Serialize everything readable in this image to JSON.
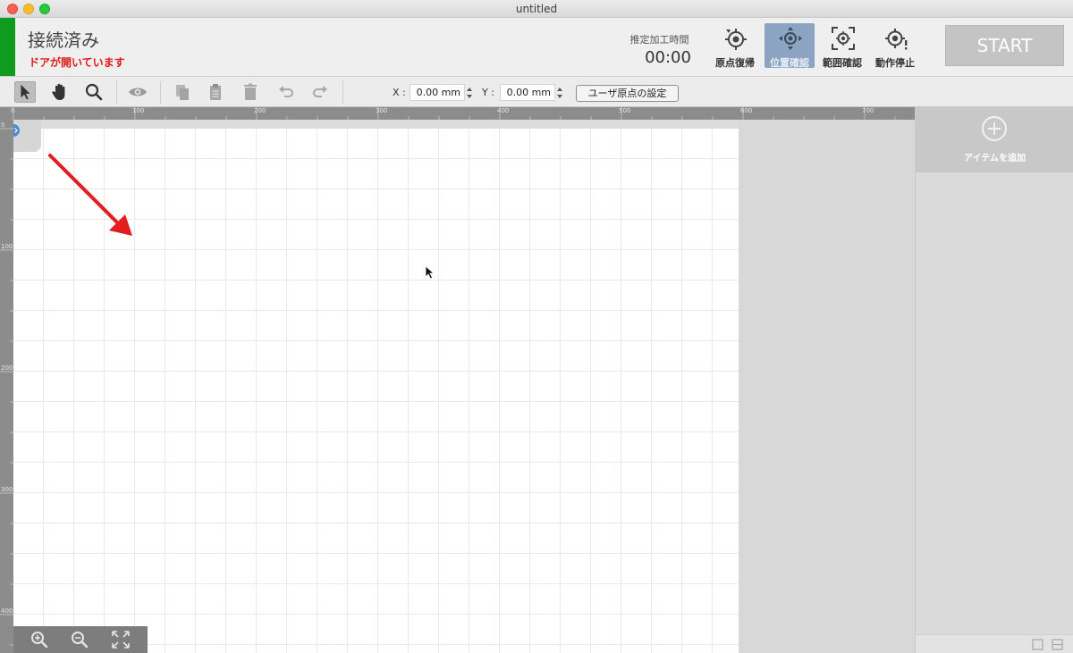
{
  "window": {
    "title": "untitled"
  },
  "header": {
    "connection_status": "接続済み",
    "door_warning": "ドアが開いています",
    "time_label": "推定加工時間",
    "time_value": "00:00",
    "tools": [
      {
        "label": "原点復帰",
        "icon": "home-target-icon"
      },
      {
        "label": "位置確認",
        "icon": "position-check-icon"
      },
      {
        "label": "範囲確認",
        "icon": "range-check-icon"
      },
      {
        "label": "動作停止",
        "icon": "stop-target-icon"
      }
    ],
    "start_label": "START",
    "status_color": "#0f9b1e",
    "warning_color": "#e01b1b"
  },
  "toolbar": {
    "x_label": "X :",
    "x_value": "0.00 mm",
    "y_label": "Y :",
    "y_value": "0.00 mm",
    "origin_button": "ユーザ原点の設定"
  },
  "rulers": {
    "top": [
      "0",
      "100",
      "200",
      "300",
      "400",
      "500",
      "600",
      "700"
    ],
    "left": [
      "0",
      "100",
      "200",
      "300",
      "400"
    ]
  },
  "right_panel": {
    "add_item_label": "アイテムを追加"
  }
}
